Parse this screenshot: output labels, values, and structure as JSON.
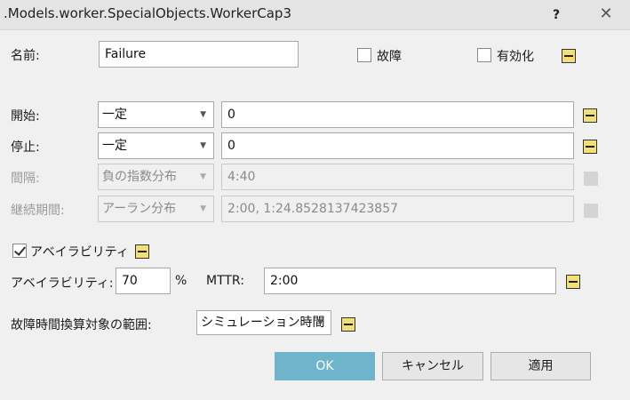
{
  "window": {
    "title": ".Models.worker.SpecialObjects.WorkerCap3",
    "help_label": "?",
    "close_label": "✕"
  },
  "name_row": {
    "label": "名前:",
    "value": "Failure",
    "failure_checkbox_label": "故障",
    "failure_checked": false,
    "enabled_checkbox_label": "有効化",
    "enabled_checked": false
  },
  "start_row": {
    "label": "開始:",
    "dist": "一定",
    "value": "0"
  },
  "stop_row": {
    "label": "停止:",
    "dist": "一定",
    "value": "0"
  },
  "interval_row": {
    "label": "間隔:",
    "dist": "負の指数分布",
    "value": "4:40"
  },
  "duration_row": {
    "label": "継続期間:",
    "dist": "アーラン分布",
    "value": "2:00, 1:24.8528137423857"
  },
  "availability": {
    "checkbox_label": "アベイラビリティ",
    "checked": true,
    "label": "アベイラビリティ:",
    "value": "70",
    "unit": "%",
    "mttr_label": "MTTR:",
    "mttr_value": "2:00"
  },
  "scope": {
    "label": "故障時間換算対象の範囲:",
    "value": "シミュレーション時間"
  },
  "buttons": {
    "ok": "OK",
    "cancel": "キャンセル",
    "apply": "適用"
  },
  "colors": {
    "pin_yellow": "#f1e07a",
    "ok_button": "#6fb4cb"
  }
}
